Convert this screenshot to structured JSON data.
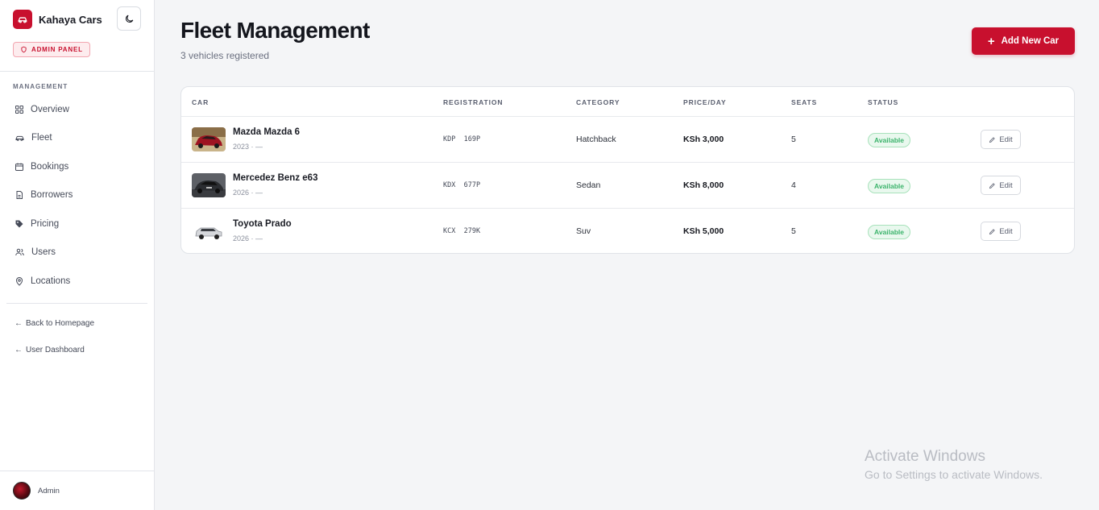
{
  "brand": {
    "name": "Kahaya Cars",
    "accent": "#c8102e"
  },
  "sidebar": {
    "badge": "ADMIN PANEL",
    "section_label": "MANAGEMENT",
    "items": [
      {
        "label": "Overview",
        "icon": "grid-icon"
      },
      {
        "label": "Fleet",
        "icon": "car-icon"
      },
      {
        "label": "Bookings",
        "icon": "calendar-icon"
      },
      {
        "label": "Borrowers",
        "icon": "document-icon"
      },
      {
        "label": "Pricing",
        "icon": "tag-icon"
      },
      {
        "label": "Users",
        "icon": "users-icon"
      },
      {
        "label": "Locations",
        "icon": "map-pin-icon"
      }
    ],
    "links": [
      {
        "label": "Back to Homepage"
      },
      {
        "label": "User Dashboard"
      }
    ],
    "user": {
      "name": "Admin"
    }
  },
  "header": {
    "title": "Fleet Management",
    "subtitle": "3 vehicles registered",
    "add_button": "Add New Car"
  },
  "table": {
    "columns": [
      "CAR",
      "REGISTRATION",
      "CATEGORY",
      "PRICE/DAY",
      "SEATS",
      "STATUS"
    ],
    "rows": [
      {
        "name": "Mazda Mazda 6",
        "year": "2023 · —",
        "registration": "KDP  169P",
        "category": "Hatchback",
        "price": "KSh 3,000",
        "seats": "5",
        "status": "Available",
        "action": "Edit"
      },
      {
        "name": "Mercedez Benz e63",
        "year": "2026 · —",
        "registration": "KDX  677P",
        "category": "Sedan",
        "price": "KSh 8,000",
        "seats": "4",
        "status": "Available",
        "action": "Edit"
      },
      {
        "name": "Toyota Prado",
        "year": "2026 · —",
        "registration": "KCX  279K",
        "category": "Suv",
        "price": "KSh 5,000",
        "seats": "5",
        "status": "Available",
        "action": "Edit"
      }
    ]
  },
  "watermark": {
    "title": "Activate Windows",
    "subtitle": "Go to Settings to activate Windows."
  }
}
